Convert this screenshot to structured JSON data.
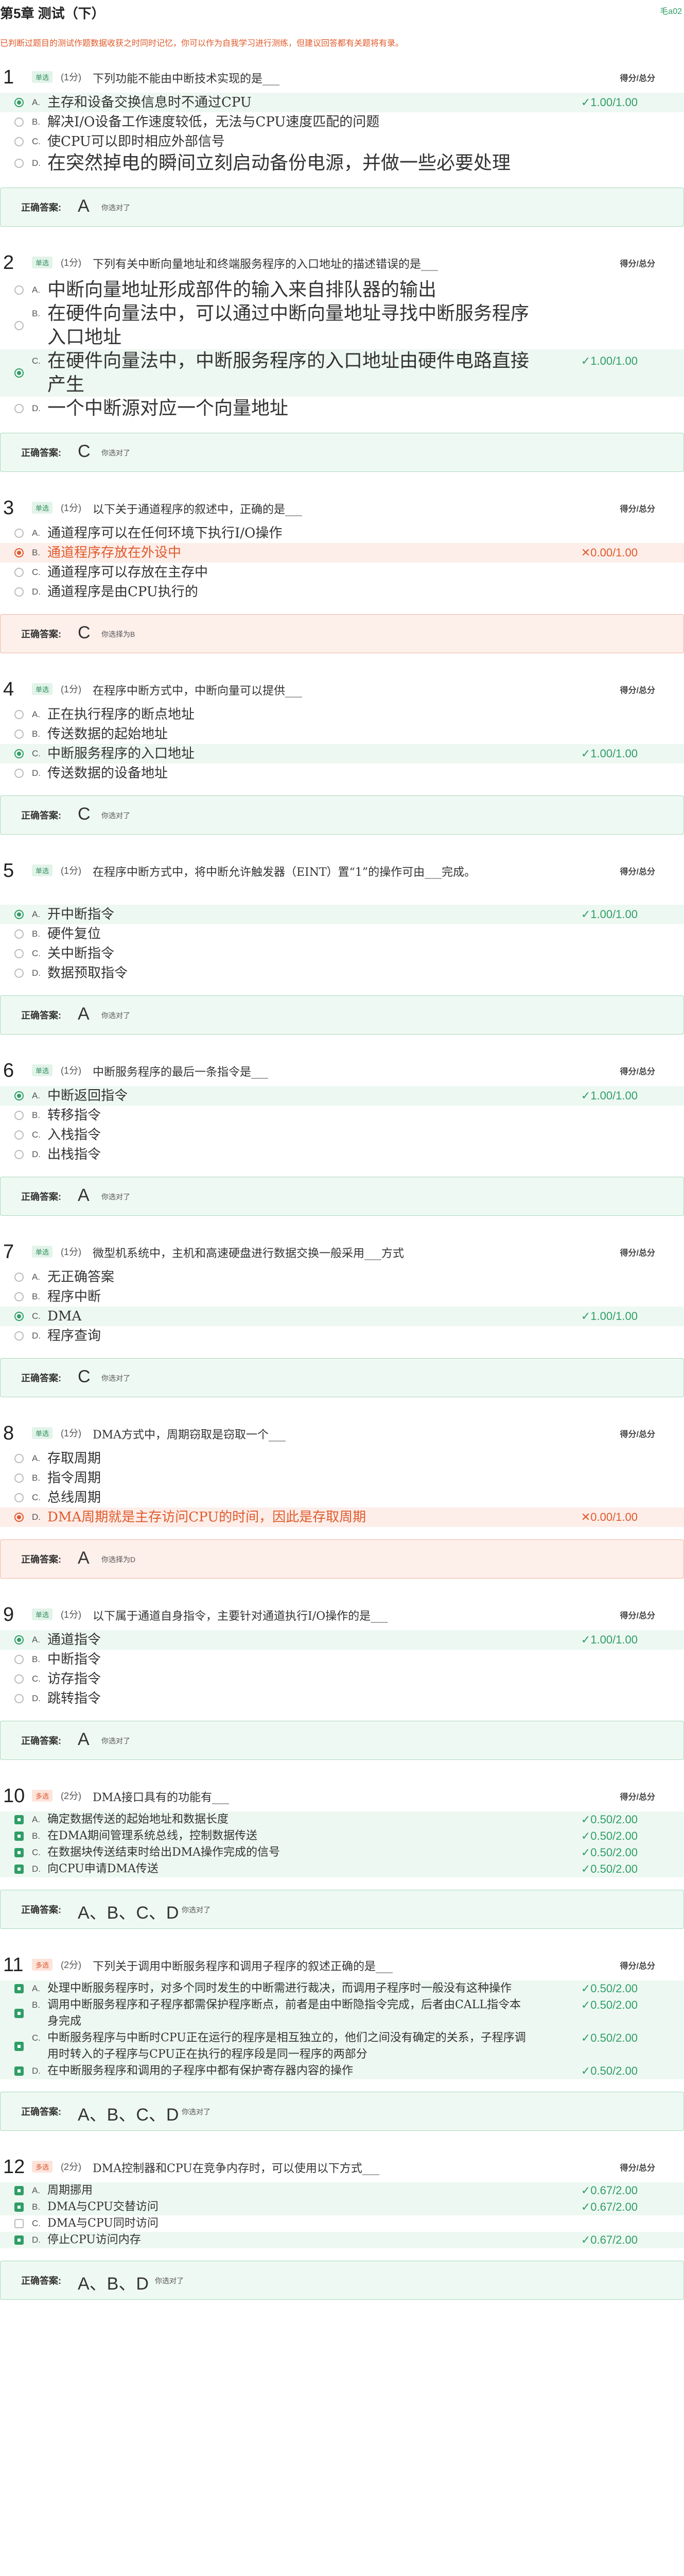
{
  "header": {
    "title": "第5章 测试（下）",
    "top_link": "毛a02",
    "notice": "已判断过题目的测试作题数据收获之时同时记忆，你可以作为自我学习进行测练，但建议回答都有关题将有录。"
  },
  "labels": {
    "score_header": "得分/总分",
    "answer_label": "正确答案:"
  },
  "questions": [
    {
      "num": "1",
      "type": "单选",
      "score": "(1分)",
      "stem": "下列功能不能由中断技术实现的是___",
      "options": [
        {
          "letter": "A.",
          "text": "主存和设备交换信息时不通过CPU",
          "state": "sel-ok",
          "score": "✓1.00/1.00"
        },
        {
          "letter": "B.",
          "text": "解决I/O设备工作速度较低，无法与CPU速度匹配的问题",
          "state": "",
          "score": ""
        },
        {
          "letter": "C.",
          "text": "使CPU可以即时相应外部信号",
          "state": "",
          "score": ""
        },
        {
          "letter": "D.",
          "text": "在突然掉电的瞬间立刻启动备份电源，并做一些必要处理",
          "state": "",
          "score": ""
        }
      ],
      "answer": "A",
      "note": "你选对了",
      "correct": true
    },
    {
      "num": "2",
      "type": "单选",
      "score": "(1分)",
      "stem": "下列有关中断向量地址和终端服务程序的入口地址的描述错误的是___",
      "options": [
        {
          "letter": "A.",
          "text": "中断向量地址形成部件的输入来自排队器的输出",
          "state": "",
          "score": ""
        },
        {
          "letter": "B.",
          "text": "在硬件向量法中，可以通过中断向量地址寻找中断服务程序入口地址",
          "state": "",
          "score": ""
        },
        {
          "letter": "C.",
          "text": "在硬件向量法中，中断服务程序的入口地址由硬件电路直接产生",
          "state": "sel-ok",
          "score": "✓1.00/1.00"
        },
        {
          "letter": "D.",
          "text": "一个中断源对应一个向量地址",
          "state": "",
          "score": ""
        }
      ],
      "answer": "C",
      "note": "你选对了",
      "correct": true
    },
    {
      "num": "3",
      "type": "单选",
      "score": "(1分)",
      "stem": "以下关于通道程序的叙述中，正确的是___",
      "options": [
        {
          "letter": "A.",
          "text": "通道程序可以在任何环境下执行I/O操作",
          "state": "",
          "score": ""
        },
        {
          "letter": "B.",
          "text": "通道程序存放在外设中",
          "state": "sel-bad",
          "score": "✕0.00/1.00"
        },
        {
          "letter": "C.",
          "text": "通道程序可以存放在主存中",
          "state": "",
          "score": ""
        },
        {
          "letter": "D.",
          "text": "通道程序是由CPU执行的",
          "state": "",
          "score": ""
        }
      ],
      "answer": "C",
      "note": "你选择为B",
      "correct": false
    },
    {
      "num": "4",
      "type": "单选",
      "score": "(1分)",
      "stem": "在程序中断方式中，中断向量可以提供___",
      "options": [
        {
          "letter": "A.",
          "text": "正在执行程序的断点地址",
          "state": "",
          "score": ""
        },
        {
          "letter": "B.",
          "text": "传送数据的起始地址",
          "state": "",
          "score": ""
        },
        {
          "letter": "C.",
          "text": "中断服务程序的入口地址",
          "state": "sel-ok",
          "score": "✓1.00/1.00"
        },
        {
          "letter": "D.",
          "text": "传送数据的设备地址",
          "state": "",
          "score": ""
        }
      ],
      "answer": "C",
      "note": "你选对了",
      "correct": true
    },
    {
      "num": "5",
      "type": "单选",
      "score": "(1分)",
      "stem": "在程序中断方式中，将中断允许触发器（EINT）置“1”的操作可由___完成。",
      "options": [
        {
          "letter": "A.",
          "text": "开中断指令",
          "state": "sel-ok",
          "score": "✓1.00/1.00"
        },
        {
          "letter": "B.",
          "text": "硬件复位",
          "state": "",
          "score": ""
        },
        {
          "letter": "C.",
          "text": "关中断指令",
          "state": "",
          "score": ""
        },
        {
          "letter": "D.",
          "text": "数据预取指令",
          "state": "",
          "score": ""
        }
      ],
      "answer": "A",
      "note": "你选对了",
      "correct": true
    },
    {
      "num": "6",
      "type": "单选",
      "score": "(1分)",
      "stem": "中断服务程序的最后一条指令是___",
      "options": [
        {
          "letter": "A.",
          "text": "中断返回指令",
          "state": "sel-ok",
          "score": "✓1.00/1.00"
        },
        {
          "letter": "B.",
          "text": "转移指令",
          "state": "",
          "score": ""
        },
        {
          "letter": "C.",
          "text": "入栈指令",
          "state": "",
          "score": ""
        },
        {
          "letter": "D.",
          "text": "出栈指令",
          "state": "",
          "score": ""
        }
      ],
      "answer": "A",
      "note": "你选对了",
      "correct": true
    },
    {
      "num": "7",
      "type": "单选",
      "score": "(1分)",
      "stem": "微型机系统中，主机和高速硬盘进行数据交换一般采用___方式",
      "options": [
        {
          "letter": "A.",
          "text": "无正确答案",
          "state": "",
          "score": ""
        },
        {
          "letter": "B.",
          "text": "程序中断",
          "state": "",
          "score": ""
        },
        {
          "letter": "C.",
          "text": "DMA",
          "state": "sel-ok",
          "score": "✓1.00/1.00"
        },
        {
          "letter": "D.",
          "text": "程序查询",
          "state": "",
          "score": ""
        }
      ],
      "answer": "C",
      "note": "你选对了",
      "correct": true
    },
    {
      "num": "8",
      "type": "单选",
      "score": "(1分)",
      "stem": "DMA方式中，周期窃取是窃取一个___",
      "options": [
        {
          "letter": "A.",
          "text": "存取周期",
          "state": "",
          "score": ""
        },
        {
          "letter": "B.",
          "text": "指令周期",
          "state": "",
          "score": ""
        },
        {
          "letter": "C.",
          "text": "总线周期",
          "state": "",
          "score": ""
        },
        {
          "letter": "D.",
          "text": "DMA周期就是主存访问CPU的时间，因此是存取周期",
          "state": "sel-bad",
          "score": "✕0.00/1.00"
        }
      ],
      "answer": "A",
      "note": "你选择为D",
      "correct": false
    },
    {
      "num": "9",
      "type": "单选",
      "score": "(1分)",
      "stem": "以下属于通道自身指令，主要针对通道执行I/O操作的是___",
      "options": [
        {
          "letter": "A.",
          "text": "通道指令",
          "state": "sel-ok",
          "score": "✓1.00/1.00"
        },
        {
          "letter": "B.",
          "text": "中断指令",
          "state": "",
          "score": ""
        },
        {
          "letter": "C.",
          "text": "访存指令",
          "state": "",
          "score": ""
        },
        {
          "letter": "D.",
          "text": "跳转指令",
          "state": "",
          "score": ""
        }
      ],
      "answer": "A",
      "note": "你选对了",
      "correct": true
    },
    {
      "num": "10",
      "type": "多选",
      "score": "(2分)",
      "stem": "DMA接口具有的功能有___",
      "options": [
        {
          "letter": "A.",
          "text": "确定数据传送的起始地址和数据长度",
          "state": "sel-ok",
          "score": "✓0.50/2.00"
        },
        {
          "letter": "B.",
          "text": "在DMA期间管理系统总线，控制数据传送",
          "state": "sel-ok",
          "score": "✓0.50/2.00"
        },
        {
          "letter": "C.",
          "text": "在数据块传送结束时给出DMA操作完成的信号",
          "state": "sel-ok",
          "score": "✓0.50/2.00"
        },
        {
          "letter": "D.",
          "text": "向CPU申请DMA传送",
          "state": "sel-ok",
          "score": "✓0.50/2.00"
        }
      ],
      "answer": "A、B、C、D",
      "note": "你选对了",
      "correct": true
    },
    {
      "num": "11",
      "type": "多选",
      "score": "(2分)",
      "stem": "下列关于调用中断服务程序和调用子程序的叙述正确的是___",
      "options": [
        {
          "letter": "A.",
          "text": "处理中断服务程序时，对多个同时发生的中断需进行裁决，而调用子程序时一般没有这种操作",
          "state": "sel-ok",
          "score": "✓0.50/2.00"
        },
        {
          "letter": "B.",
          "text": "调用中断服务程序和子程序都需保护程序断点，前者是由中断隐指令完成，后者由CALL指令本身完成",
          "state": "sel-ok",
          "score": "✓0.50/2.00"
        },
        {
          "letter": "C.",
          "text": "中断服务程序与中断时CPU正在运行的程序是相互独立的，他们之间没有确定的关系，子程序调用时转入的子程序与CPU正在执行的程序段是同一程序的两部分",
          "state": "sel-ok",
          "score": "✓0.50/2.00"
        },
        {
          "letter": "D.",
          "text": "在中断服务程序和调用的子程序中都有保护寄存器内容的操作",
          "state": "sel-ok",
          "score": "✓0.50/2.00"
        }
      ],
      "answer": "A、B、C、D",
      "note": "你选对了",
      "correct": true
    },
    {
      "num": "12",
      "type": "多选",
      "score": "(2分)",
      "stem": "DMA控制器和CPU在竞争内存时，可以使用以下方式___",
      "options": [
        {
          "letter": "A.",
          "text": "周期挪用",
          "state": "sel-ok",
          "score": "✓0.67/2.00"
        },
        {
          "letter": "B.",
          "text": "DMA与CPU交替访问",
          "state": "sel-ok",
          "score": "✓0.67/2.00"
        },
        {
          "letter": "C.",
          "text": "DMA与CPU同时访问",
          "state": "",
          "score": ""
        },
        {
          "letter": "D.",
          "text": "停止CPU访问内存",
          "state": "sel-ok",
          "score": "✓0.67/2.00"
        }
      ],
      "answer": "A、B、D",
      "note": "你选对了",
      "correct": true
    }
  ]
}
